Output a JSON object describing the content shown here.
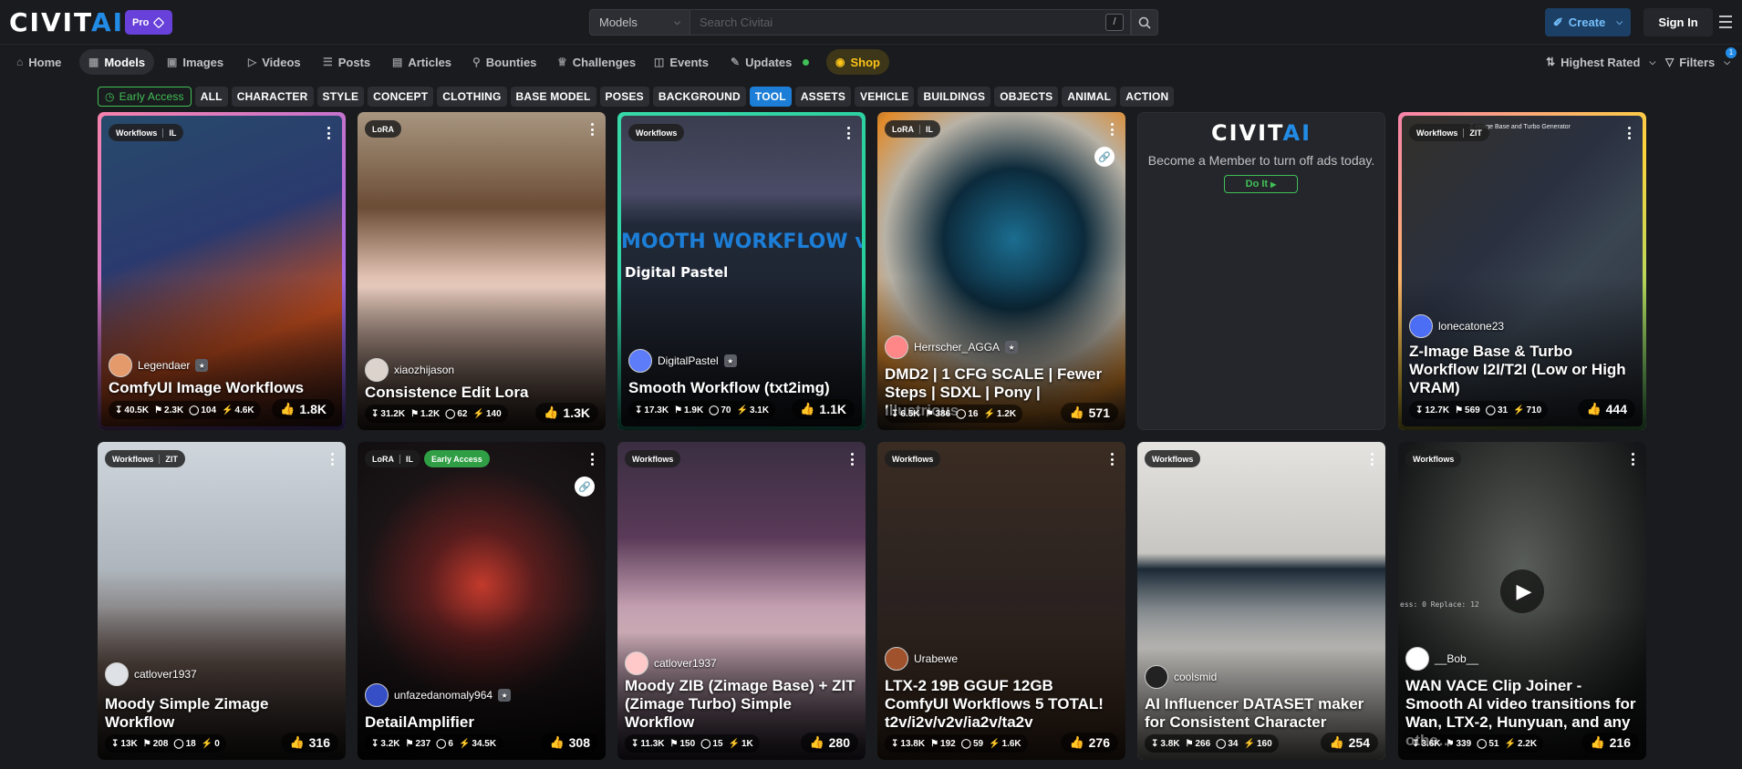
{
  "header": {
    "logo_main": "CIVIT",
    "logo_ai": "AI",
    "pro_label": "Pro",
    "search_scope": "Models",
    "search_placeholder": "Search Civitai",
    "search_shortcut": "/",
    "create_label": "Create",
    "signin_label": "Sign In"
  },
  "nav": {
    "items": [
      "Home",
      "Models",
      "Images",
      "Videos",
      "Posts",
      "Articles",
      "Bounties",
      "Challenges",
      "Events",
      "Updates",
      "Shop"
    ],
    "sort_label": "Highest Rated",
    "filters_label": "Filters",
    "filters_count": "1"
  },
  "tags": {
    "early_access": "Early Access",
    "items": [
      "ALL",
      "CHARACTER",
      "STYLE",
      "CONCEPT",
      "CLOTHING",
      "BASE MODEL",
      "POSES",
      "BACKGROUND",
      "TOOL",
      "ASSETS",
      "VEHICLE",
      "BUILDINGS",
      "OBJECTS",
      "ANIMAL",
      "ACTION"
    ],
    "selected": "TOOL"
  },
  "ad": {
    "text": "Become a Member to turn off ads today.",
    "button": "Do It"
  },
  "cards": [
    {
      "badges": [
        "Workflows",
        "IL"
      ],
      "author": "Legendaer",
      "title": "ComfyUI Image Workflows",
      "downloads": "40.5K",
      "saves": "2.3K",
      "comments": "104",
      "buzz": "4.6K",
      "likes": "1.8K"
    },
    {
      "badges": [
        "LoRA"
      ],
      "author": "xiaozhijason",
      "title": "Consistence Edit Lora",
      "downloads": "31.2K",
      "saves": "1.2K",
      "comments": "62",
      "buzz": "140",
      "likes": "1.3K"
    },
    {
      "badges": [
        "Workflows"
      ],
      "author": "DigitalPastel",
      "title": "Smooth Workflow (txt2img)",
      "downloads": "17.3K",
      "saves": "1.9K",
      "comments": "70",
      "buzz": "3.1K",
      "likes": "1.1K",
      "image_text_1": "MOOTH WORKFLOW v",
      "image_text_2": "Digital Pastel"
    },
    {
      "badges": [
        "LoRA",
        "IL"
      ],
      "author": "Herrscher_AGGA",
      "title": "DMD2 | 1 CFG SCALE | Fewer Steps | SDXL | Pony | Illustrious",
      "downloads": "6.5K",
      "saves": "386",
      "comments": "16",
      "buzz": "1.2K",
      "likes": "571"
    },
    {
      "badges": [
        "Workflows",
        "ZIT"
      ],
      "author": "lonecatone23",
      "title": "Z-Image Base & Turbo Workflow I2I/T2I (Low or High VRAM)",
      "downloads": "12.7K",
      "saves": "569",
      "comments": "31",
      "buzz": "710",
      "likes": "444",
      "image_text_1": "Z-Image Base and Turbo Generator"
    },
    {
      "badges": [
        "Workflows",
        "ZIT"
      ],
      "author": "catlover1937",
      "title": "Moody Simple Zimage Workflow",
      "downloads": "13K",
      "saves": "208",
      "comments": "18",
      "buzz": "0",
      "likes": "316"
    },
    {
      "badges": [
        "LoRA",
        "IL",
        "Early Access"
      ],
      "author": "unfazedanomaly964",
      "title": "DetailAmplifier",
      "downloads": "3.2K",
      "saves": "237",
      "comments": "6",
      "buzz": "34.5K",
      "likes": "308"
    },
    {
      "badges": [
        "Workflows"
      ],
      "author": "catlover1937",
      "title": "Moody ZIB (Zimage Base) + ZIT (Zimage Turbo) Simple Workflow",
      "downloads": "11.3K",
      "saves": "150",
      "comments": "15",
      "buzz": "1K",
      "likes": "280"
    },
    {
      "badges": [
        "Workflows"
      ],
      "author": "Urabewe",
      "title": "LTX-2 19B GGUF 12GB ComfyUI Workflows 5 TOTAL! t2v/i2v/v2v/ia2v/ta2v",
      "downloads": "13.8K",
      "saves": "192",
      "comments": "59",
      "buzz": "1.6K",
      "likes": "276"
    },
    {
      "badges": [
        "Workflows"
      ],
      "author": "coolsmid",
      "title": "AI Influencer DATASET maker for Consistent Character",
      "downloads": "3.8K",
      "saves": "266",
      "comments": "34",
      "buzz": "160",
      "likes": "254"
    },
    {
      "badges": [
        "Workflows"
      ],
      "author": "__Bob__",
      "title": "WAN VACE Clip Joiner - Smooth AI video transitions for Wan, LTX-2, Hunyuan, and any othe…",
      "downloads": "3.6K",
      "saves": "339",
      "comments": "51",
      "buzz": "2.2K",
      "likes": "216",
      "image_text_1": "ess: 0 Replace: 12"
    }
  ],
  "colors": {
    "accent": "#228be6",
    "selected_tag": "#1c7ed6",
    "early_access": "#40c057",
    "pro": "#6741d9",
    "likes": "#fab005"
  }
}
